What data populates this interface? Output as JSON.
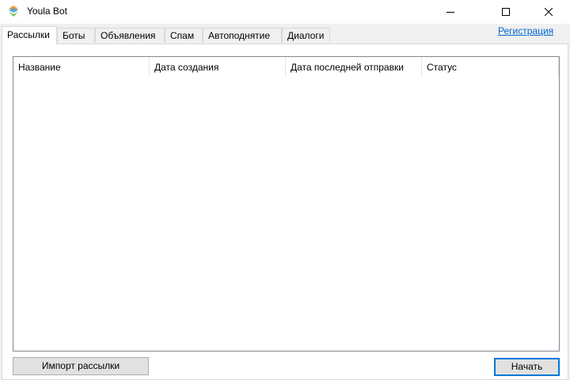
{
  "window": {
    "title": "Youla Bot",
    "controls": {
      "minimize": "–",
      "maximize": "☐",
      "close": "✕"
    }
  },
  "tabs": [
    {
      "label": "Рассылки",
      "active": true
    },
    {
      "label": "Боты",
      "active": false
    },
    {
      "label": "Объявления",
      "active": false
    },
    {
      "label": "Спам",
      "active": false
    },
    {
      "label": "Автоподнятие",
      "active": false
    },
    {
      "label": "Диалоги",
      "active": false
    }
  ],
  "register_link": "Регистрация",
  "list": {
    "columns": [
      "Название",
      "Дата создания",
      "Дата последней отправки",
      "Статус"
    ],
    "rows": []
  },
  "buttons": {
    "import": "Импорт рассылки",
    "start": "Начать"
  },
  "colors": {
    "accent": "#0078d7",
    "link": "#0066cc",
    "panel": "#f0f0f0"
  }
}
